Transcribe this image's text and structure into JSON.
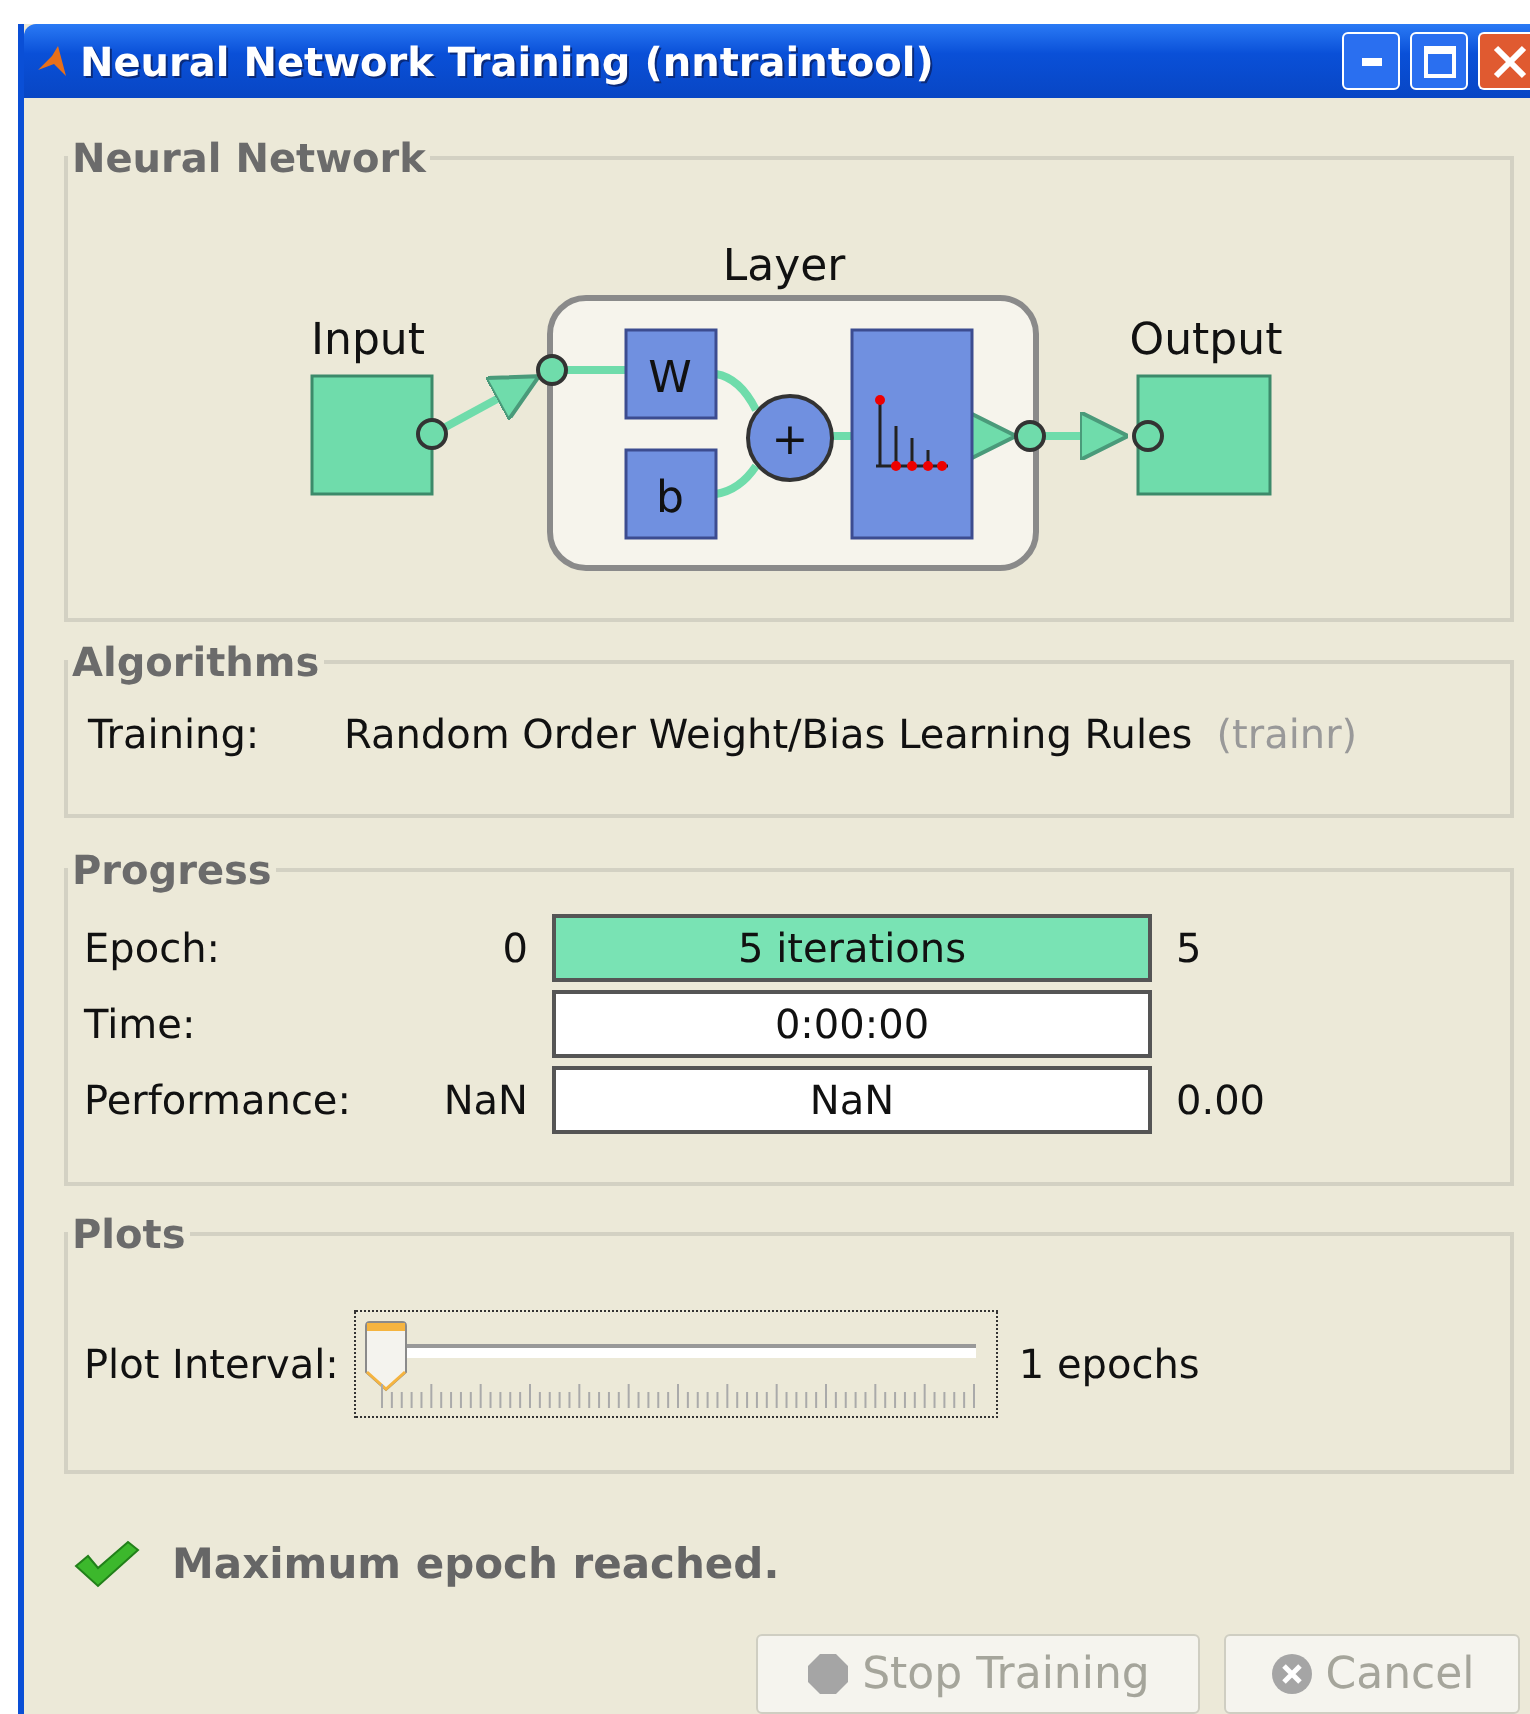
{
  "window": {
    "title": "Neural Network Training (nntraintool)"
  },
  "network": {
    "title": "Neural Network",
    "input_label": "Input",
    "layer_label": "Layer",
    "output_label": "Output",
    "weight_label": "W",
    "bias_label": "b",
    "sum_label": "+"
  },
  "algorithms": {
    "title": "Algorithms",
    "rows": [
      {
        "label": "Training:",
        "value": "Random Order Weight/Bias Learning Rules",
        "code": "(trainr)"
      }
    ]
  },
  "progress": {
    "title": "Progress",
    "rows": [
      {
        "label": "Epoch:",
        "start": "0",
        "text": "5 iterations",
        "level": 1,
        "end": "5"
      },
      {
        "label": "Time:",
        "text": "0:00:00",
        "level": 0
      },
      {
        "label": "Performance:",
        "start": "NaN",
        "text": "NaN",
        "level": 0,
        "end": "0.00"
      }
    ]
  },
  "plots": {
    "title": "Plots",
    "label": "Plot Interval:",
    "level": 0,
    "reading": "1 epochs"
  },
  "status": {
    "text": "Maximum epoch reached."
  },
  "buttons": [
    {
      "label": "Stop Training",
      "kind": "stop",
      "disabled": true
    },
    {
      "label": "Cancel",
      "kind": "cancel",
      "disabled": true
    }
  ]
}
